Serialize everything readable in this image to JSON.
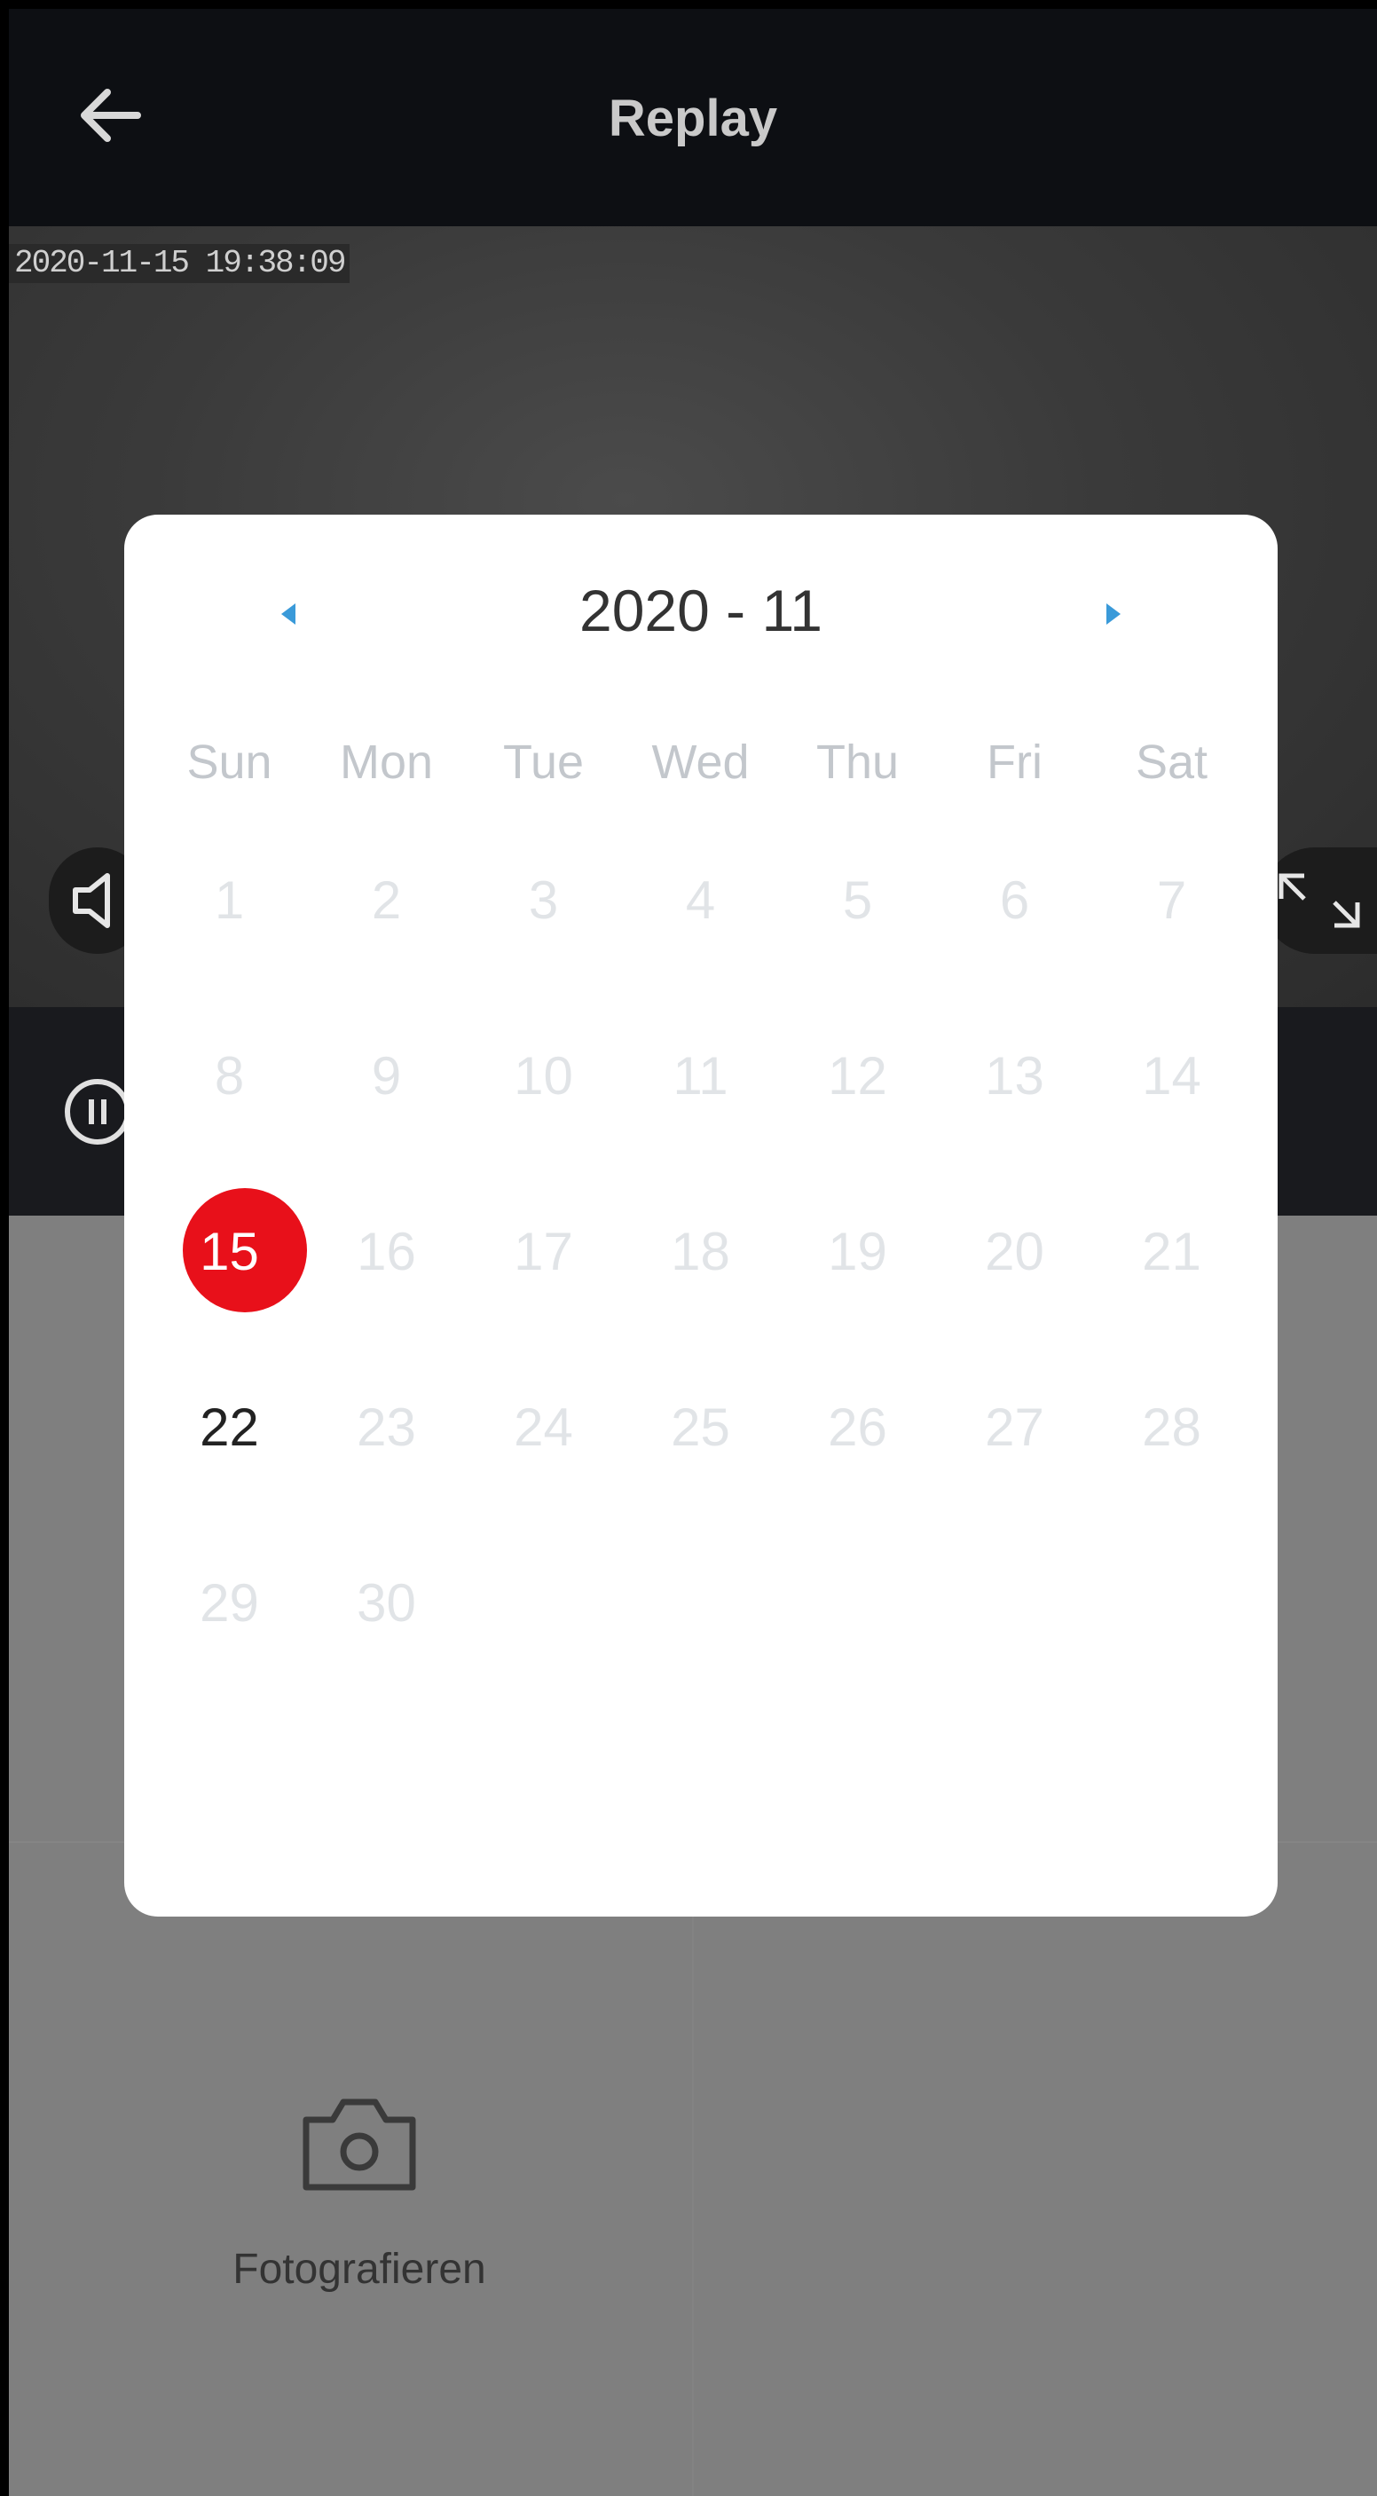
{
  "header": {
    "title": "Replay",
    "back_icon": "arrow-left-icon"
  },
  "video": {
    "timestamp": "2020-11-15 19:38:09"
  },
  "panel": {
    "photo_label": "Fotografieren"
  },
  "calendar": {
    "month_label": "2020 - 11",
    "weekdays": [
      "Sun",
      "Mon",
      "Tue",
      "Wed",
      "Thu",
      "Fri",
      "Sat"
    ],
    "weeks": [
      [
        "1",
        "2",
        "3",
        "4",
        "5",
        "6",
        "7"
      ],
      [
        "8",
        "9",
        "10",
        "11",
        "12",
        "13",
        "14"
      ],
      [
        "15",
        "16",
        "17",
        "18",
        "19",
        "20",
        "21"
      ],
      [
        "22",
        "23",
        "24",
        "25",
        "26",
        "27",
        "28"
      ],
      [
        "29",
        "30"
      ]
    ],
    "selected_day": "15",
    "active_days": [
      "15",
      "22"
    ],
    "accent_color": "#3a9ad9",
    "selected_color": "#e8101a"
  }
}
